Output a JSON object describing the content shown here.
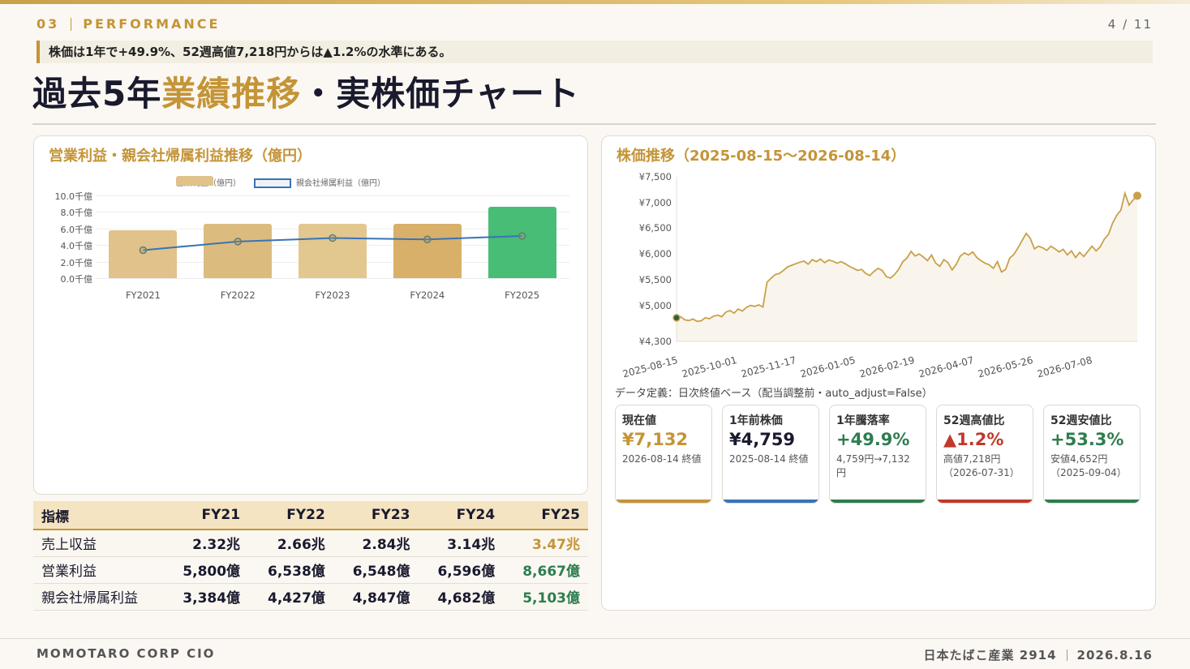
{
  "header": {
    "section_number": "03",
    "section_name": "PERFORMANCE",
    "page": "4 / 11",
    "highlight": "株価は1年で+49.9%、52週高値7,218円からは▲1.2%の水準にある。",
    "title_a": "過去5年",
    "title_accent": "業績推移",
    "title_b": "・実株価チャート"
  },
  "left_panel": {
    "title": "営業利益・親会社帰属利益推移（億円）"
  },
  "right_panel": {
    "title": "株価推移（2025-08-15〜2026-08-14）",
    "data_definition": "データ定義：日次終値ベース（配当調整前・auto_adjust=False）"
  },
  "chart_data": [
    {
      "type": "bar",
      "title": "営業利益・親会社帰属利益推移（億円）",
      "categories": [
        "FY2021",
        "FY2022",
        "FY2023",
        "FY2024",
        "FY2025"
      ],
      "series": [
        {
          "name": "営業利益（億円）",
          "type": "bar",
          "values": [
            5800,
            6538,
            6548,
            6596,
            8667
          ],
          "colors": [
            "#e0c28a",
            "#dcbb7e",
            "#e2c78f",
            "#d8b06a",
            "#47bd76"
          ]
        },
        {
          "name": "親会社帰属利益（億円）",
          "type": "line",
          "values": [
            3384,
            4427,
            4847,
            4682,
            5103
          ],
          "color": "#3a73b5"
        }
      ],
      "y_ticks": [
        "0.0千億",
        "2.0千億",
        "4.0千億",
        "6.0千億",
        "8.0千億",
        "10.0千億"
      ],
      "ylim": [
        0,
        10000
      ],
      "legend": "top",
      "grid": true
    },
    {
      "type": "area",
      "title": "株価推移（2025-08-15〜2026-08-14）",
      "x_ticks": [
        "2025-08-15",
        "2025-10-01",
        "2025-11-17",
        "2026-01-05",
        "2026-02-19",
        "2026-04-07",
        "2026-05-26",
        "2026-07-08"
      ],
      "y_ticks": [
        "¥4,300",
        "¥5,000",
        "¥5,500",
        "¥6,000",
        "¥6,500",
        "¥7,000",
        "¥7,500"
      ],
      "ylim": [
        4300,
        7500
      ],
      "color": "#c9a04a",
      "values": [
        4759,
        4780,
        4720,
        4705,
        4735,
        4690,
        4700,
        4760,
        4740,
        4790,
        4810,
        4780,
        4870,
        4900,
        4850,
        4930,
        4890,
        4960,
        5000,
        4980,
        5010,
        4970,
        5450,
        5530,
        5600,
        5620,
        5680,
        5750,
        5780,
        5810,
        5840,
        5860,
        5800,
        5890,
        5850,
        5900,
        5830,
        5880,
        5860,
        5820,
        5850,
        5810,
        5760,
        5720,
        5680,
        5700,
        5620,
        5580,
        5660,
        5720,
        5680,
        5560,
        5530,
        5600,
        5700,
        5850,
        5920,
        6050,
        5960,
        6000,
        5940,
        5870,
        5980,
        5820,
        5760,
        5890,
        5830,
        5690,
        5800,
        5960,
        6020,
        5980,
        6040,
        5930,
        5870,
        5820,
        5790,
        5720,
        5850,
        5650,
        5700,
        5920,
        5990,
        6120,
        6260,
        6400,
        6300,
        6100,
        6150,
        6120,
        6070,
        6150,
        6100,
        6040,
        6090,
        5980,
        6060,
        5930,
        6030,
        5950,
        6050,
        6150,
        6060,
        6140,
        6290,
        6380,
        6600,
        6750,
        6850,
        7180,
        6950,
        7050,
        7132
      ]
    }
  ],
  "table": {
    "headers": [
      "指標",
      "FY21",
      "FY22",
      "FY23",
      "FY24",
      "FY25"
    ],
    "rows": [
      {
        "label": "売上収益",
        "values": [
          "2.32兆",
          "2.66兆",
          "2.84兆",
          "3.14兆",
          "3.47兆"
        ]
      },
      {
        "label": "営業利益",
        "values": [
          "5,800億",
          "6,538億",
          "6,548億",
          "6,596億",
          "8,667億"
        ]
      },
      {
        "label": "親会社帰属利益",
        "values": [
          "3,384億",
          "4,427億",
          "4,847億",
          "4,682億",
          "5,103億"
        ]
      }
    ]
  },
  "cards": [
    {
      "label": "現在値",
      "value": "¥7,132",
      "sub": "2026-08-14 終値",
      "color": "#c49437"
    },
    {
      "label": "1年前株価",
      "value": "¥4,759",
      "sub": "2025-08-14 終値",
      "color": "#1a1a2e",
      "bar": "#3a73b5"
    },
    {
      "label": "1年騰落率",
      "value": "+49.9%",
      "sub": "4,759円→7,132円",
      "color": "#2e7d4f"
    },
    {
      "label": "52週高値比",
      "value": "▲1.2%",
      "sub": "高値7,218円（2026-07-31）",
      "color": "#c0392b"
    },
    {
      "label": "52週安値比",
      "value": "+53.3%",
      "sub": "安値4,652円（2025-09-04）",
      "color": "#2e7d4f"
    }
  ],
  "footer": {
    "left": "MOMOTARO CORP CIO",
    "company": "日本たばこ産業 2914",
    "date": "2026.8.16"
  }
}
